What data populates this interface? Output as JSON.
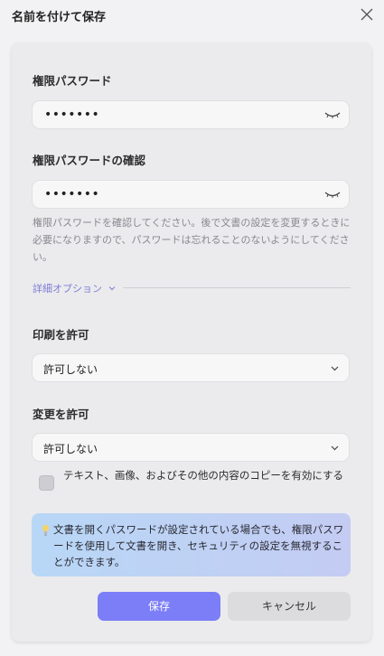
{
  "window": {
    "title": "名前を付けて保存"
  },
  "permission_password": {
    "label": "権限パスワード",
    "value": "•••••••"
  },
  "confirm_password": {
    "label": "権限パスワードの確認",
    "value": "•••••••"
  },
  "help_text": "権限パスワードを確認してください。後で文書の設定を変更するときに必要になりますので、パスワードは忘れることのないようにしてください。",
  "advanced_options": {
    "label": "詳細オプション"
  },
  "print_permission": {
    "label": "印刷を許可",
    "selected": "許可しない"
  },
  "change_permission": {
    "label": "変更を許可",
    "selected": "許可しない"
  },
  "copy_checkbox": {
    "label": "テキスト、画像、およびその他の内容のコピーを有効にする",
    "checked": false
  },
  "info_box": {
    "text": "文書を開くパスワードが設定されている場合でも、権限パスワードを使用して文書を開き、セキュリティの設定を無視することができます。",
    "icon": "lightbulb-icon"
  },
  "buttons": {
    "save": "保存",
    "cancel": "キャンセル"
  },
  "colors": {
    "accent": "#7b7ef6",
    "link": "#7f7cd6",
    "info_bg_start": "#b8d7f6",
    "info_bg_end": "#c4ccf3"
  }
}
